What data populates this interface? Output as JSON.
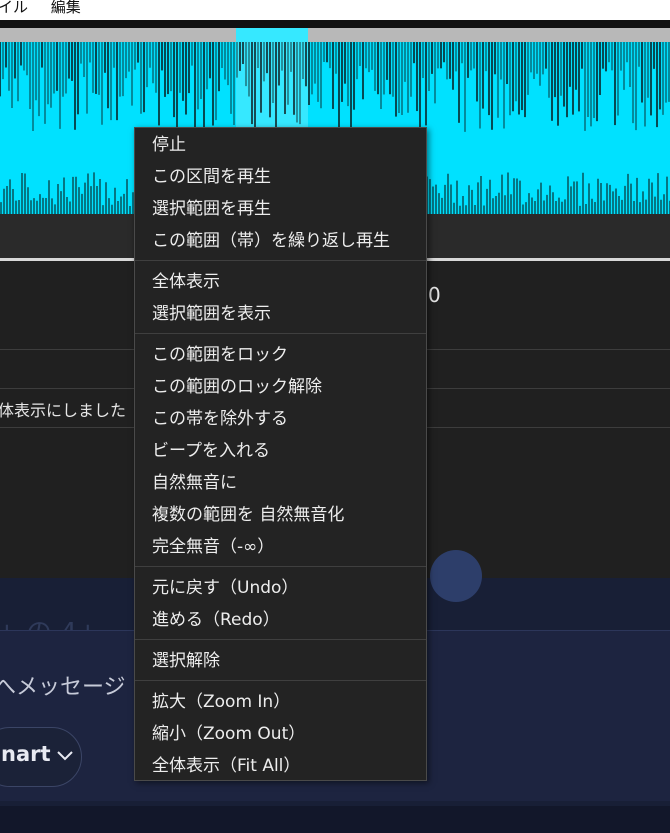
{
  "menubar": {
    "items": [
      "イル",
      "編集"
    ]
  },
  "panel": {
    "number_fragment": "0",
    "status_text": "体表示にしました"
  },
  "chat": {
    "ghost_text": "+ の 4+ ",
    "placeholder": "へメッセージ",
    "model_label": "nart"
  },
  "context_menu": {
    "groups": [
      [
        "停止",
        "この区間を再生",
        "選択範囲を再生",
        "この範囲（帯）を繰り返し再生"
      ],
      [
        "全体表示",
        "選択範囲を表示"
      ],
      [
        "この範囲をロック",
        "この範囲のロック解除",
        "この帯を除外する",
        "ビープを入れる",
        "自然無音に",
        "複数の範囲を 自然無音化",
        "完全無音（-∞）"
      ],
      [
        "元に戻す（Undo）",
        "進める（Redo）"
      ],
      [
        "選択解除"
      ],
      [
        "拡大（Zoom In）",
        "縮小（Zoom Out）",
        "全体表示（Fit All）"
      ]
    ]
  },
  "colors": {
    "waveform": "#00e1ff",
    "menu_bg": "#232323",
    "chat_bg": "#181f36"
  },
  "icons": {
    "model_dropdown": "chevron-down-icon"
  }
}
